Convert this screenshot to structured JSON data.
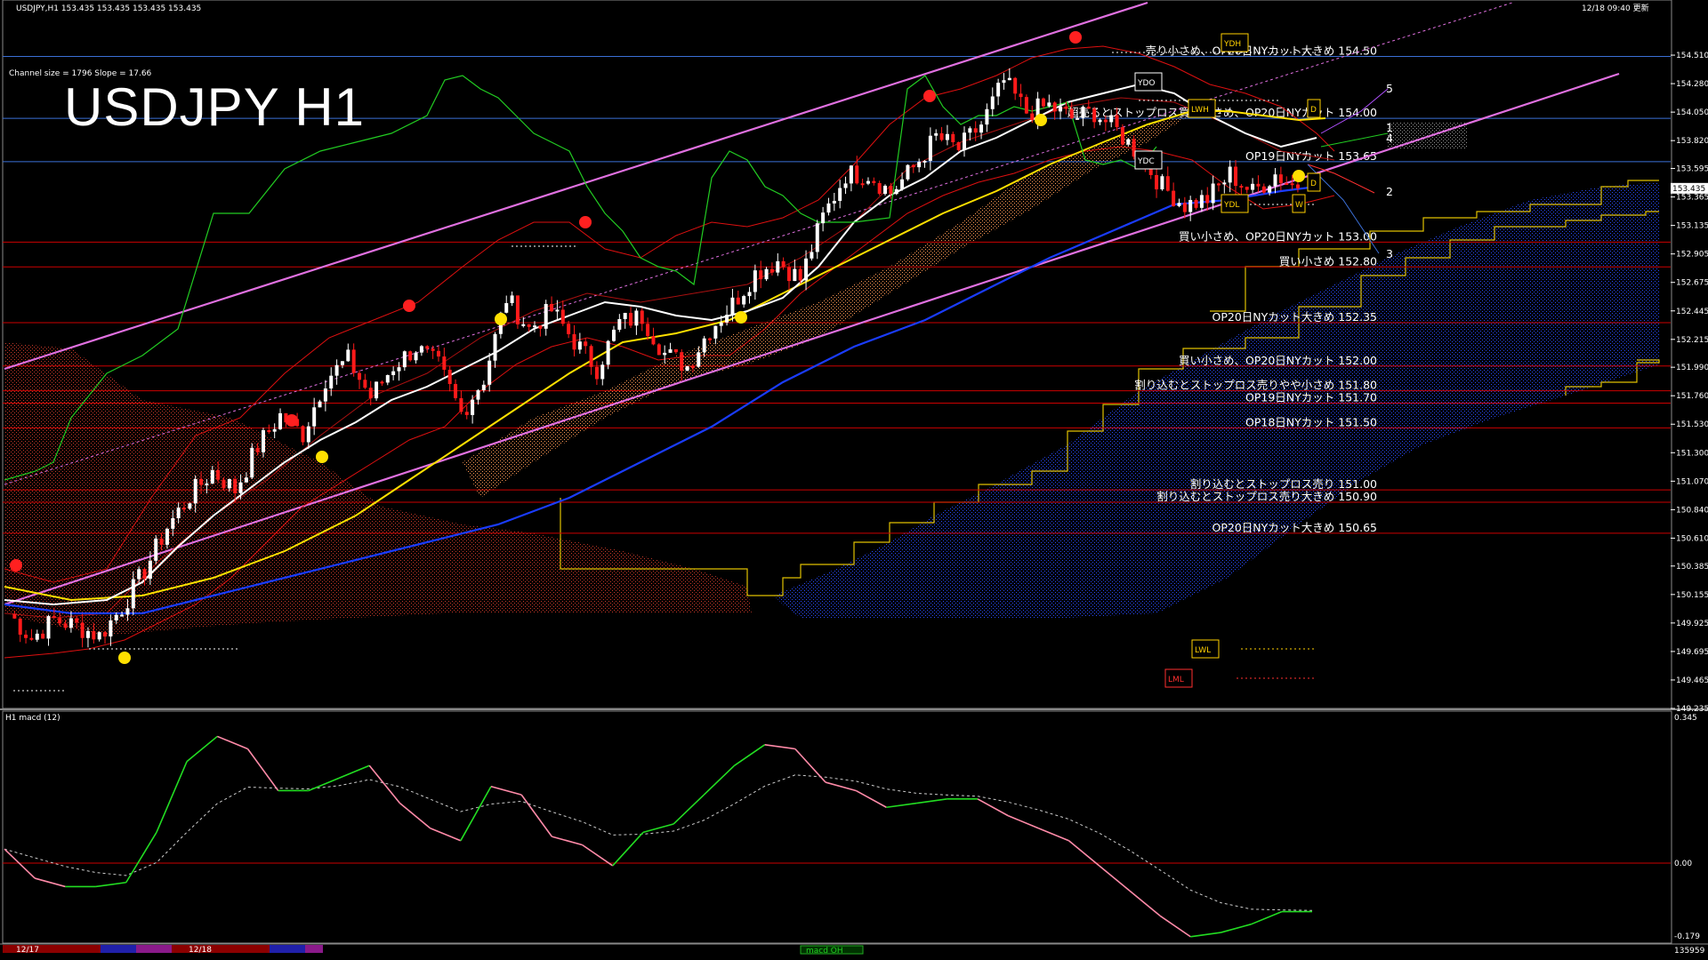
{
  "header": {
    "symbol_line": "USDJPY,H1  153.435 153.435 153.435 153.435",
    "datetime": "12/18 09:40 更新",
    "channel_info": "Channel size = 1796 Slope = 17.66",
    "title": "USDJPY H1"
  },
  "macd": {
    "label": "H1  macd (12)",
    "ticks": [
      "0.345",
      "0.00",
      "-0.179"
    ],
    "footer_label": "macd OH",
    "footer_right": "135959"
  },
  "time_labels": [
    "12/17",
    "12/18"
  ],
  "colors": {
    "resistance_line": "#cc0000",
    "blue_line": "#3b6fd6",
    "channel": "#e070e0",
    "ma_white": "#ffffff",
    "ma_yellow": "#ffe000",
    "ma_blue": "#1a3cff",
    "green": "#22dd22",
    "pink": "#ff8aa8"
  },
  "chart_data": {
    "type": "line",
    "title": "USDJPY H1",
    "ylim": [
      149.235,
      154.74
    ],
    "y_ticks": [
      154.51,
      154.28,
      154.05,
      153.82,
      153.595,
      153.365,
      153.135,
      152.905,
      152.675,
      152.445,
      152.215,
      151.99,
      151.76,
      151.53,
      151.3,
      151.07,
      150.84,
      150.61,
      150.385,
      150.155,
      149.925,
      149.695,
      149.465,
      149.235
    ],
    "y_tick_labels": [
      "154.510",
      "154.280",
      "154.050",
      "153.820",
      "153.595",
      "153.365",
      "153.135",
      "152.905",
      "152.675",
      "152.445",
      "152.215",
      "151.990",
      "151.760",
      "151.530",
      "151.300",
      "151.070",
      "150.840",
      "150.610",
      "150.385",
      "150.155",
      "149.925",
      "149.695",
      "149.465",
      "149.235"
    ],
    "current_price": 153.435,
    "current_price_label": "153.435",
    "levels": [
      {
        "text": "売り小さめ、OP20日NYカット大きめ 154.50",
        "value": 154.5,
        "color": "blue"
      },
      {
        "text": "超売るとストップロス買い小さめ、OP20日NYカット 154.00",
        "value": 154.0,
        "color": "blue"
      },
      {
        "text": "OP19日NYカット 153.65",
        "value": 153.65,
        "color": "blue"
      },
      {
        "text": "買い小さめ、OP20日NYカット 153.00",
        "value": 153.0,
        "color": "red"
      },
      {
        "text": "買い小さめ 152.80",
        "value": 152.8,
        "color": "red"
      },
      {
        "text": "OP20日NYカット大きめ 152.35",
        "value": 152.35,
        "color": "red"
      },
      {
        "text": "買い小さめ、OP20日NYカット 152.00",
        "value": 152.0,
        "color": "red"
      },
      {
        "text": "割り込むとストップロス売りやや小さめ 151.80",
        "value": 151.8,
        "color": "red"
      },
      {
        "text": "OP19日NYカット 151.70",
        "value": 151.7,
        "color": "red"
      },
      {
        "text": "OP18日NYカット 151.50",
        "value": 151.5,
        "color": "red"
      },
      {
        "text": "割り込むとストップロス売り 151.00",
        "value": 151.0,
        "color": "red"
      },
      {
        "text": "割り込むとストップロス売り大きめ 150.90",
        "value": 150.9,
        "color": "red"
      },
      {
        "text": "OP20日NYカット大きめ 150.65",
        "value": 150.65,
        "color": "red"
      }
    ],
    "markers": [
      {
        "text": "YDH",
        "value": 154.42,
        "color": "#ffd000"
      },
      {
        "text": "YDO",
        "value": 154.0,
        "color": "#ffffff"
      },
      {
        "text": "LWH",
        "value": 153.73,
        "color": "#ffd000"
      },
      {
        "text": "D",
        "value": 153.77,
        "color": "#ffd000"
      },
      {
        "text": "YDC",
        "value": 153.44,
        "color": "#ffffff"
      },
      {
        "text": "D",
        "value": 153.3,
        "color": "#ffd000"
      },
      {
        "text": "YDL",
        "value": 153.13,
        "color": "#ffd000"
      },
      {
        "text": "W",
        "value": 153.13,
        "color": "#ffd000"
      },
      {
        "text": "LWL",
        "value": 149.66,
        "color": "#ffd000"
      },
      {
        "text": "LML",
        "value": 149.44,
        "color": "#ff3030"
      }
    ],
    "wave_labels": [
      "5",
      "1",
      "4",
      "2",
      "3"
    ],
    "price_path": [
      150.0,
      149.8,
      149.95,
      149.9,
      149.82,
      150.05,
      150.35,
      150.7,
      150.95,
      151.15,
      151.0,
      151.35,
      151.6,
      151.45,
      151.9,
      152.05,
      151.75,
      152.0,
      152.15,
      152.0,
      151.62,
      151.9,
      152.55,
      152.3,
      152.45,
      152.2,
      151.98,
      152.35,
      152.4,
      152.1,
      152.0,
      152.3,
      152.5,
      152.75,
      152.85,
      152.7,
      153.2,
      153.55,
      153.55,
      153.4,
      153.6,
      153.85,
      153.75,
      153.95,
      154.3,
      154.05,
      154.1,
      154.0,
      154.05,
      153.9,
      153.7,
      153.45,
      153.3,
      153.35,
      153.55,
      153.4,
      153.55,
      153.435
    ],
    "macd_path": [
      0.04,
      -0.03,
      -0.05,
      -0.05,
      -0.04,
      0.08,
      0.25,
      0.31,
      0.28,
      0.18,
      0.18,
      0.21,
      0.24,
      0.15,
      0.09,
      0.06,
      0.19,
      0.17,
      0.07,
      0.05,
      0.0,
      0.08,
      0.1,
      0.17,
      0.24,
      0.29,
      0.28,
      0.2,
      0.18,
      0.14,
      0.15,
      0.16,
      0.16,
      0.12,
      0.09,
      0.06,
      0.0,
      -0.06,
      -0.12,
      -0.17,
      -0.16,
      -0.14,
      -0.11,
      -0.11
    ]
  }
}
